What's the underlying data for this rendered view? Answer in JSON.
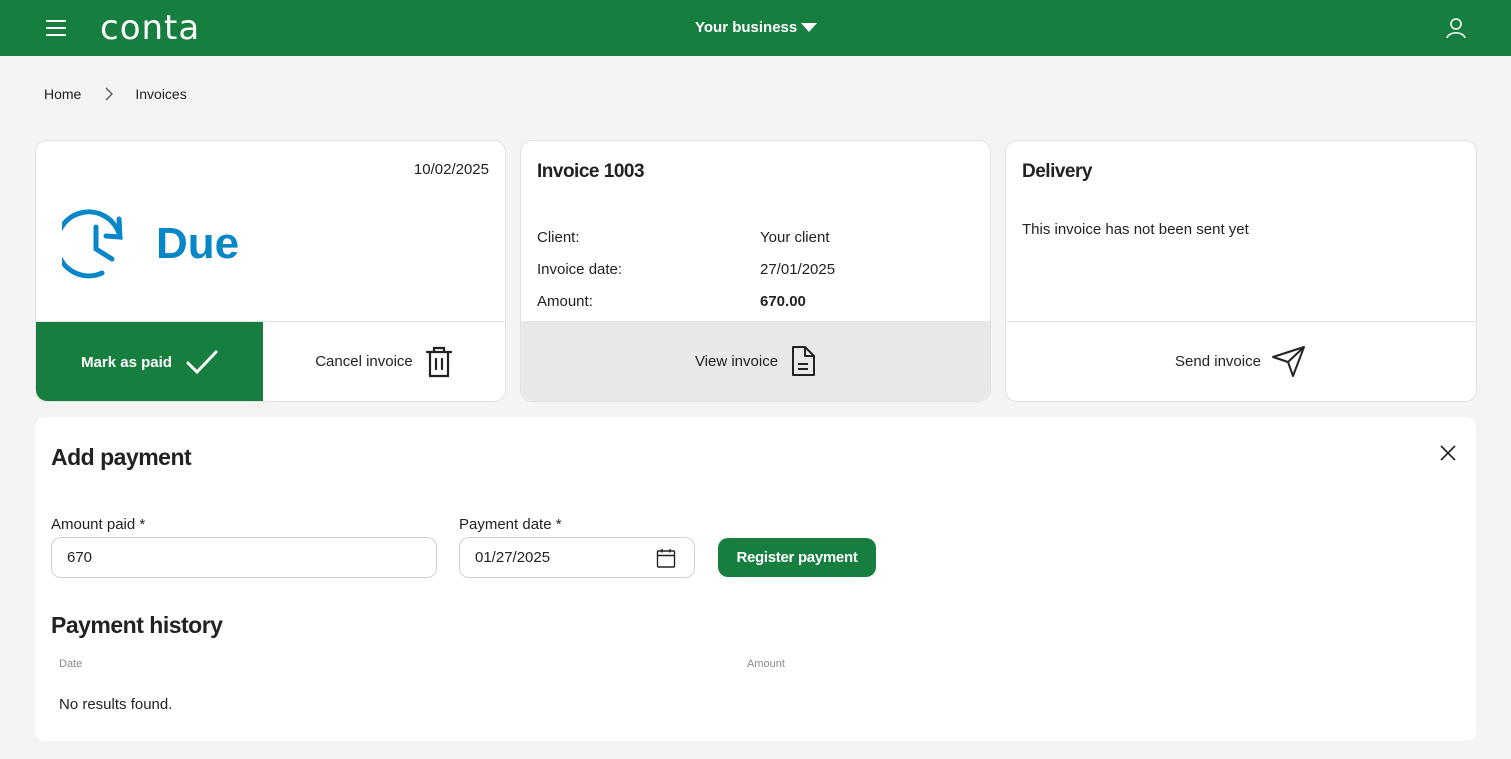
{
  "header": {
    "logo_text": "conta",
    "business_label": "Your business",
    "icons": {
      "menu": "hamburger-icon",
      "user": "user-icon",
      "business": "caret-down-icon"
    }
  },
  "breadcrumb": [
    {
      "label": "Home"
    },
    {
      "label": "Invoices"
    }
  ],
  "status_card": {
    "date": "10/02/2025",
    "status": "Due",
    "status_color": "#0787c8",
    "status_icon": "clock-refresh-icon",
    "mark_paid_label": "Mark as paid",
    "cancel_label": "Cancel invoice"
  },
  "invoice_card": {
    "title": "Invoice 1003",
    "rows": [
      {
        "key": "Client:",
        "value": "Your client"
      },
      {
        "key": "Invoice date:",
        "value": "27/01/2025"
      },
      {
        "key": "Amount:",
        "value": "670.00"
      }
    ],
    "view_label": "View invoice"
  },
  "delivery_card": {
    "title": "Delivery",
    "message": "This invoice has not been sent yet",
    "send_label": "Send invoice"
  },
  "add_payment": {
    "title": "Add payment",
    "amount_label": "Amount paid *",
    "amount_value": "670",
    "date_label": "Payment date *",
    "date_value": "01/27/2025",
    "register_label": "Register payment"
  },
  "payment_history": {
    "title": "Payment history",
    "columns": [
      "Date",
      "Amount"
    ],
    "empty_text": "No results found."
  },
  "colors": {
    "brand": "#167f40",
    "status_due": "#0787c8"
  }
}
